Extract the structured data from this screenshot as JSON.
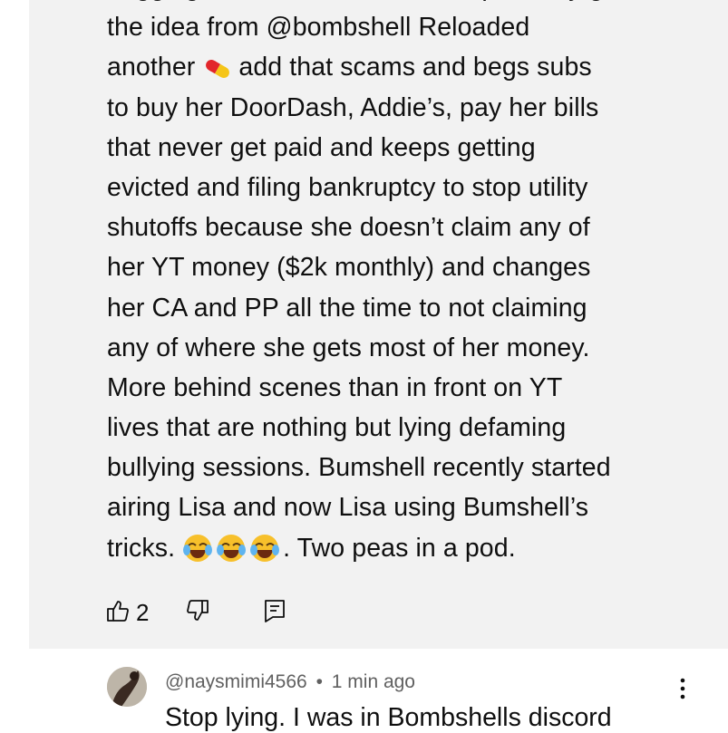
{
  "comment": {
    "lines": [
      "begging in the comment section probably got",
      "the idea from @bombshell Reloaded",
      "another",
      "add that scams and begs subs",
      "to buy her DoorDash, Addie’s, pay her bills",
      "that never get paid and keeps getting",
      "evicted and filing bankruptcy to stop utility",
      "shutoffs because she doesn’t claim any of",
      "her YT money ($2k monthly) and changes",
      "her CA and PP all the time to not claiming",
      "any of where she gets most of her money.",
      "More behind scenes than in front on YT",
      "lives that are nothing but lying defaming",
      "bullying sessions. Bumshell recently started",
      "airing Lisa and now Lisa using Bumshell’s",
      "tricks.",
      ". Two peas in a pod."
    ],
    "icons": {
      "pill": "pill-emoji",
      "laugh": "tears-of-joy-emoji"
    },
    "like_count": "2"
  },
  "reply": {
    "author": "@naysmimi4566",
    "separator": "•",
    "time": "1 min ago",
    "text": "Stop lying. I was in Bombshells discord"
  },
  "colors": {
    "card_bg": "#f2f2f2",
    "meta_gray": "#606060",
    "text": "#0f0f0f"
  }
}
